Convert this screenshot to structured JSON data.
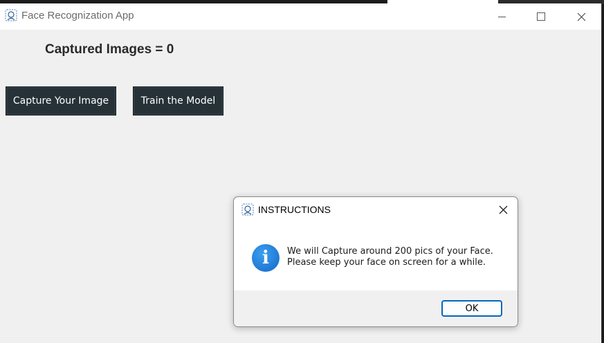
{
  "window": {
    "title": "Face Recognization App",
    "minimize_icon": "minimize-icon",
    "maximize_icon": "maximize-icon",
    "close_icon": "close-icon"
  },
  "main": {
    "captured_label": "Captured Images = 0",
    "capture_button": "Capture Your Image",
    "train_button": "Train the Model",
    "button_color": "#263238"
  },
  "dialog": {
    "title": "INSTRUCTIONS",
    "icon": "info-icon",
    "message_line1": "We will Capture around 200 pics of your Face.",
    "message_line2": "Please keep your face on screen for a while.",
    "ok_label": "OK",
    "accent": "#0067c0"
  }
}
